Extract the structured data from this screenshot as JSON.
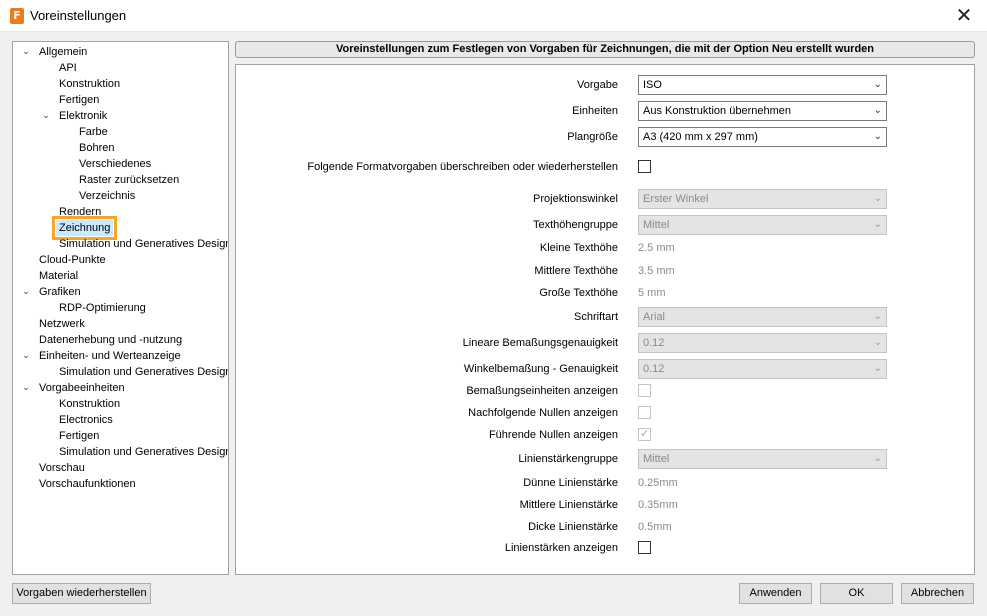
{
  "window": {
    "title": "Voreinstellungen",
    "app_icon_letter": "F",
    "close_glyph": "✕"
  },
  "tree": [
    {
      "label": "Allgemein",
      "expanded": true
    },
    {
      "label": "API"
    },
    {
      "label": "Konstruktion"
    },
    {
      "label": "Fertigen"
    },
    {
      "label": "Elektronik",
      "expanded": true
    },
    {
      "label": "Farbe"
    },
    {
      "label": "Bohren"
    },
    {
      "label": "Verschiedenes"
    },
    {
      "label": "Raster zurücksetzen"
    },
    {
      "label": "Verzeichnis"
    },
    {
      "label": "Rendern"
    },
    {
      "label": "Zeichnung",
      "selected": true
    },
    {
      "label": "Simulation und Generatives Design"
    },
    {
      "label": "Cloud-Punkte"
    },
    {
      "label": "Material"
    },
    {
      "label": "Grafiken",
      "expanded": true
    },
    {
      "label": "RDP-Optimierung"
    },
    {
      "label": "Netzwerk"
    },
    {
      "label": "Datenerhebung und -nutzung"
    },
    {
      "label": "Einheiten- und Werteanzeige",
      "expanded": true
    },
    {
      "label": "Simulation und Generatives Design"
    },
    {
      "label": "Vorgabeeinheiten",
      "expanded": true
    },
    {
      "label": "Konstruktion"
    },
    {
      "label": "Electronics"
    },
    {
      "label": "Fertigen"
    },
    {
      "label": "Simulation und Generatives Design"
    },
    {
      "label": "Vorschau"
    },
    {
      "label": "Vorschaufunktionen"
    }
  ],
  "panel": {
    "header": "Voreinstellungen zum Festlegen von Vorgaben für Zeichnungen, die mit der Option Neu erstellt wurden",
    "vorgabe": {
      "label": "Vorgabe",
      "value": "ISO"
    },
    "einheiten": {
      "label": "Einheiten",
      "value": "Aus Konstruktion übernehmen"
    },
    "plangroesse": {
      "label": "Plangröße",
      "value": "A3 (420 mm x 297 mm)"
    },
    "override": {
      "label": "Folgende Formatvorgaben überschreiben oder wiederherstellen",
      "checked": false
    },
    "projektionswinkel": {
      "label": "Projektionswinkel",
      "value": "Erster Winkel"
    },
    "texthoehengruppe": {
      "label": "Texthöhengruppe",
      "value": "Mittel"
    },
    "kleine_texthoehe": {
      "label": "Kleine Texthöhe",
      "value": "2.5 mm"
    },
    "mittlere_texthoehe": {
      "label": "Mittlere Texthöhe",
      "value": "3.5 mm"
    },
    "grosse_texthoehe": {
      "label": "Große Texthöhe",
      "value": "5 mm"
    },
    "schriftart": {
      "label": "Schriftart",
      "value": "Arial"
    },
    "lineare_genauigkeit": {
      "label": "Lineare Bemaßungsgenauigkeit",
      "value": "0.12"
    },
    "winkel_genauigkeit": {
      "label": "Winkelbemaßung - Genauigkeit",
      "value": "0.12"
    },
    "bemassungseinheiten": {
      "label": "Bemaßungseinheiten anzeigen",
      "checked": false
    },
    "nachfolgende_nullen": {
      "label": "Nachfolgende Nullen anzeigen",
      "checked": false
    },
    "fuehrende_nullen": {
      "label": "Führende Nullen anzeigen",
      "checked": true
    },
    "linienstaerkengruppe": {
      "label": "Linienstärkengruppe",
      "value": "Mittel"
    },
    "duenne_linienstaerke": {
      "label": "Dünne Linienstärke",
      "value": "0.25mm"
    },
    "mittlere_linienstaerke": {
      "label": "Mittlere Linienstärke",
      "value": "0.35mm"
    },
    "dicke_linienstaerke": {
      "label": "Dicke Linienstärke",
      "value": "0.5mm"
    },
    "linienstaerken_anzeigen": {
      "label": "Linienstärken anzeigen",
      "checked": false
    }
  },
  "buttons": {
    "restore": "Vorgaben wiederherstellen",
    "apply": "Anwenden",
    "ok": "OK",
    "cancel": "Abbrechen"
  },
  "icons": {
    "dropdown": "chevron-down-icon",
    "expanded": "chevron-down-icon",
    "check": "checkmark-icon"
  },
  "colors": {
    "selection_bg": "#cce8ff",
    "highlight_outline": "#f5a623",
    "app_icon": "#f07b1d"
  }
}
